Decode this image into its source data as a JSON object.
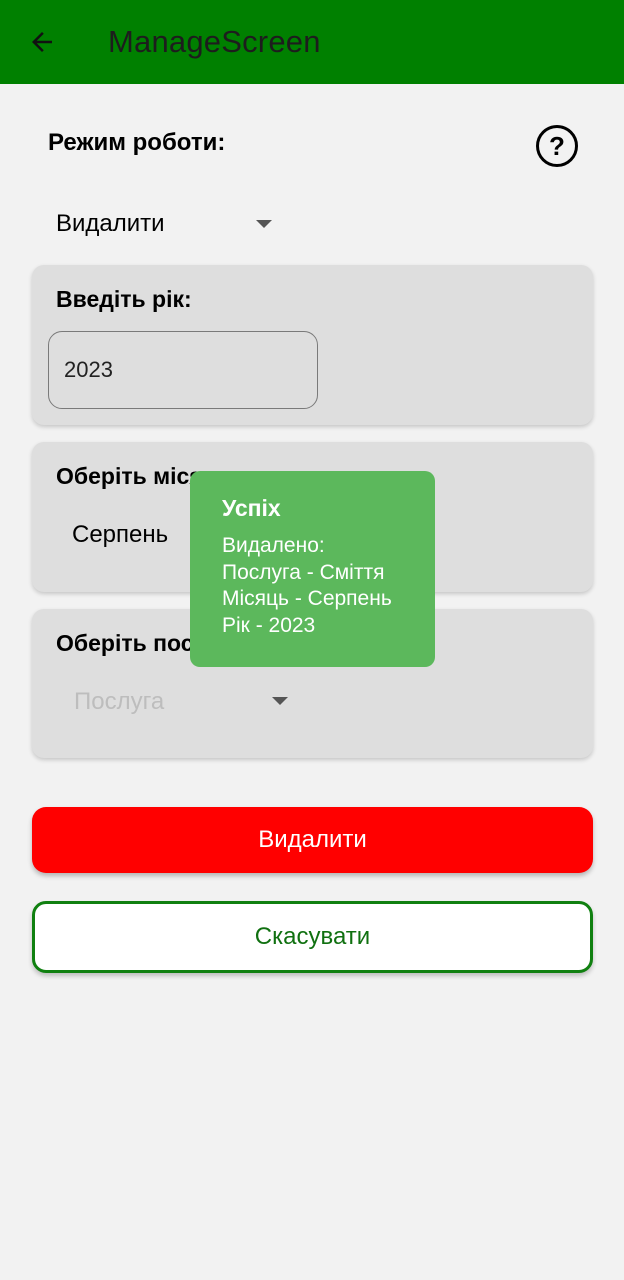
{
  "appbar": {
    "title": "ManageScreen",
    "back_icon": "arrow-left-icon",
    "color": "#008000"
  },
  "mode": {
    "label": "Режим роботи:",
    "help_icon": "question-circle-icon",
    "help_glyph": "?",
    "selected": "Видалити"
  },
  "year_card": {
    "title": "Введіть рік:",
    "value": "2023"
  },
  "month_card": {
    "title": "Оберіть місяць:",
    "selected": "Серпень"
  },
  "service_card": {
    "title": "Оберіть послугу:",
    "placeholder": "Послуга"
  },
  "buttons": {
    "delete_label": "Видалити",
    "delete_color": "#ff0000",
    "cancel_label": "Скасувати",
    "cancel_color": "#108010"
  },
  "toast": {
    "title": "Успіх",
    "lines": [
      "Видалено:",
      "Послуга - Сміття",
      "Місяць - Серпень",
      "Рік - 2023"
    ],
    "color": "#5cb85c"
  }
}
